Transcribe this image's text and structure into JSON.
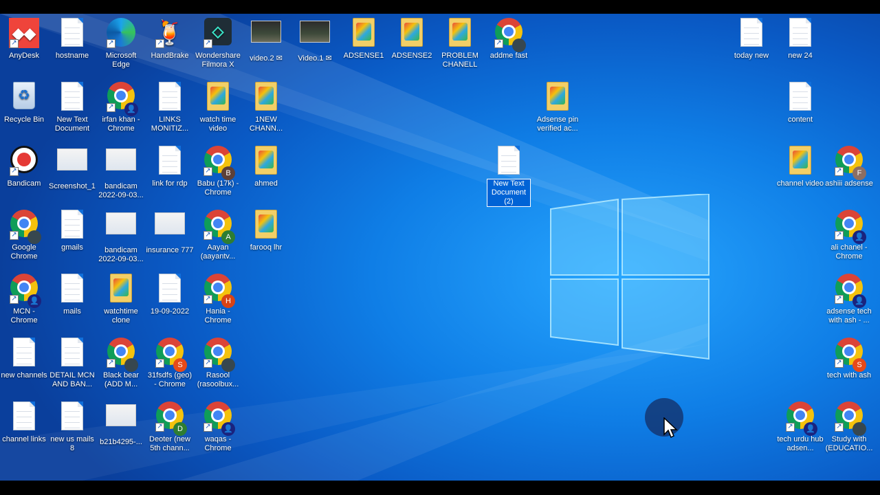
{
  "desktop": {
    "icons": [
      {
        "label": "AnyDesk",
        "type": "anydesk"
      },
      {
        "label": "hostname",
        "type": "doc"
      },
      {
        "label": "Microsoft Edge",
        "type": "edge"
      },
      {
        "label": "HandBrake",
        "type": "handbrake"
      },
      {
        "label": "Wondershare Filmora X",
        "type": "filmora"
      },
      {
        "label": "video.2 ✉",
        "type": "video"
      },
      {
        "label": "Video.1 ✉",
        "type": "video"
      },
      {
        "label": "ADSENSE1",
        "type": "folder"
      },
      {
        "label": "ADSENSE2",
        "type": "folder"
      },
      {
        "label": "PROBLEM CHANELL",
        "type": "folder"
      },
      {
        "label": "addme fast",
        "type": "chrome",
        "avatar": ""
      },
      {
        "label": "Recycle Bin",
        "type": "recycle"
      },
      {
        "label": "New Text Document",
        "type": "doc"
      },
      {
        "label": "irfan khan - Chrome",
        "type": "chrome",
        "avatar": "👤"
      },
      {
        "label": "LINKS MONITIZ...",
        "type": "doc"
      },
      {
        "label": "watch time video",
        "type": "folder"
      },
      {
        "label": "1NEW CHANN...",
        "type": "folder"
      },
      {
        "label": "Adsense pin verified ac...",
        "type": "folder"
      },
      {
        "label": "Bandicam",
        "type": "bandicam"
      },
      {
        "label": "Screenshot_1",
        "type": "thumb"
      },
      {
        "label": "bandicam 2022-09-03...",
        "type": "thumb"
      },
      {
        "label": "link for rdp",
        "type": "doc"
      },
      {
        "label": "Babu (17k) - Chrome",
        "type": "chrome",
        "avatar": "B"
      },
      {
        "label": "ahmed",
        "type": "folder"
      },
      {
        "label": "New Text Document (2)",
        "type": "doc"
      },
      {
        "label": "Google Chrome",
        "type": "chrome",
        "avatar": ""
      },
      {
        "label": "gmails",
        "type": "doc"
      },
      {
        "label": "bandicam 2022-09-03...",
        "type": "thumb"
      },
      {
        "label": "insurance 777",
        "type": "thumb"
      },
      {
        "label": "Aayan (aayantv...",
        "type": "chrome",
        "avatar": "A"
      },
      {
        "label": "farooq lhr",
        "type": "folder"
      },
      {
        "label": "MCN - Chrome",
        "type": "chrome",
        "avatar": "👤"
      },
      {
        "label": "mails",
        "type": "doc"
      },
      {
        "label": "watchtime clone",
        "type": "folder"
      },
      {
        "label": "19-09-2022",
        "type": "doc"
      },
      {
        "label": "Hania - Chrome",
        "type": "chrome",
        "avatar": "H"
      },
      {
        "label": "new channels",
        "type": "doc"
      },
      {
        "label": "DETAIL MCN AND BAN...",
        "type": "doc"
      },
      {
        "label": "Black bear (ADD M...",
        "type": "chrome",
        "avatar": ""
      },
      {
        "label": "31fsdfs (geo) - Chrome",
        "type": "chrome",
        "avatar": "S"
      },
      {
        "label": "Rasool (rasoolbux...",
        "type": "chrome",
        "avatar": ""
      },
      {
        "label": "channel links",
        "type": "doc"
      },
      {
        "label": "new us mails 8",
        "type": "doc"
      },
      {
        "label": "b21b4295-...",
        "type": "thumb"
      },
      {
        "label": "Deoter (new 5th chann...",
        "type": "chrome",
        "avatar": "D"
      },
      {
        "label": "waqas - Chrome",
        "type": "chrome",
        "avatar": "👤"
      },
      {
        "label": "today new",
        "type": "doc"
      },
      {
        "label": "new 24",
        "type": "doc"
      },
      {
        "label": "content",
        "type": "doc"
      },
      {
        "label": "channel video",
        "type": "folder"
      },
      {
        "label": "ashiii adsense",
        "type": "chrome",
        "avatar": "F"
      },
      {
        "label": "ali chanel - Chrome",
        "type": "chrome",
        "avatar": "👤"
      },
      {
        "label": "adsense tech with ash - ...",
        "type": "chrome",
        "avatar": "👤"
      },
      {
        "label": "tech with ash",
        "type": "chrome",
        "avatar": "S"
      },
      {
        "label": "tech urdu hub adsen...",
        "type": "chrome",
        "avatar": "👤"
      },
      {
        "label": "Study with (EDUCATIO...",
        "type": "chrome",
        "avatar": ""
      }
    ],
    "selected_index": 24
  },
  "colors": {
    "accent": "#0063d6",
    "background": "#0f7ee6"
  }
}
